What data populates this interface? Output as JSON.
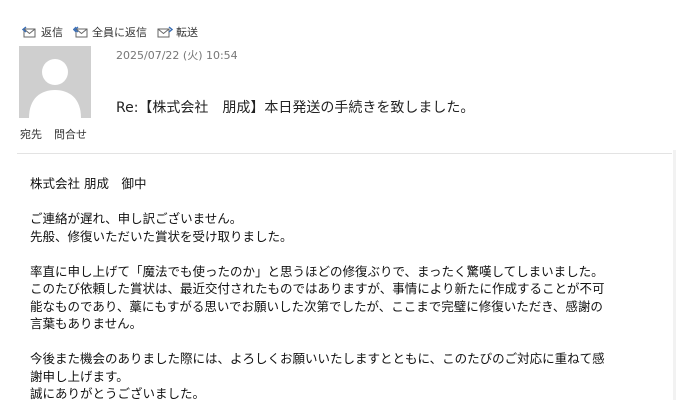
{
  "toolbar": {
    "reply": "返信",
    "reply_all": "全員に返信",
    "forward": "転送"
  },
  "header": {
    "date": "2025/07/22 (火) 10:54",
    "subject": "Re:【株式会社　朋成】本日発送の手続きを致しました。",
    "to_label": "宛先",
    "inquiry_label": "問合せ"
  },
  "body": {
    "lines": [
      "株式会社 朋成　御中",
      "",
      "ご連絡が遅れ、申し訳ございません。",
      "先般、修復いただいた賞状を受け取りました。",
      "",
      "率直に申し上げて「魔法でも使ったのか」と思うほどの修復ぶりで、まったく驚嘆してしまいました。",
      "このたび依頼した賞状は、最近交付されたものではありますが、事情により新たに作成することが不可",
      "能なものであり、藁にもすがる思いでお願いした次第でしたが、ここまで完璧に修復いただき、感謝の",
      "言葉もありません。",
      "",
      "今後また機会のありました際には、よろしくお願いいたしますとともに、このたびのご対応に重ねて感",
      "謝申し上げます。",
      "誠にありがとうございました。"
    ]
  },
  "icons": {
    "reply": "reply-icon",
    "reply_all": "reply-all-icon",
    "forward": "forward-icon",
    "avatar": "person-silhouette"
  },
  "colors": {
    "icon_blue": "#3b6fb6",
    "avatar_bg": "#cfcfcf",
    "meta_gray": "#777777"
  }
}
